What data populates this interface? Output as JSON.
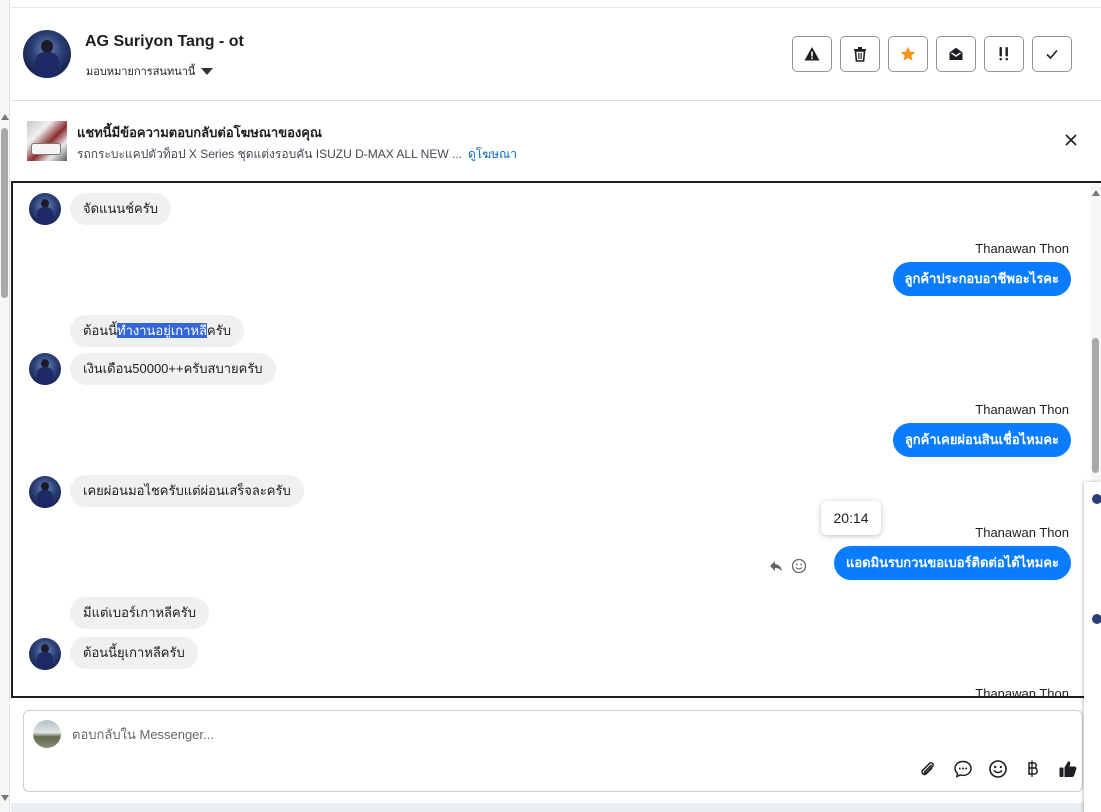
{
  "header": {
    "contact_name": "AG Suriyon Tang - ot",
    "assign_label": "มอบหมายการสนทนานี้",
    "actions": [
      {
        "name": "spam-button",
        "icon": "warning-icon"
      },
      {
        "name": "delete-button",
        "icon": "trash-icon"
      },
      {
        "name": "star-button",
        "icon": "star-icon"
      },
      {
        "name": "mark-unread-button",
        "icon": "envelope-open-icon"
      },
      {
        "name": "follow-up-button",
        "icon": "double-exclamation-icon"
      },
      {
        "name": "done-button",
        "icon": "check-icon"
      }
    ]
  },
  "ad_banner": {
    "title": "แชทนี้มีข้อความตอบกลับต่อโฆษณาของคุณ",
    "subtitle": "รถกระบะแคปตัวท็อป X Series ชุดแต่งรอบคัน ISUZU D-MAX ALL NEW ...",
    "link_label": "ดูโฆษณา"
  },
  "conversation": {
    "agent_name": "Thanawan Thon",
    "tooltip_time": "20:14",
    "messages": [
      {
        "from": "customer",
        "text": "จัดแนนช์ครับ"
      },
      {
        "from": "agent",
        "text": "ลูกค้าประกอบอาชีพอะไรคะ"
      },
      {
        "from": "customer",
        "text_before": "ต้อนนี้",
        "text_highlight": "ทำงานอยู่เกาหลี",
        "text_after": "ครับ"
      },
      {
        "from": "customer",
        "text": "เงินเดือน50000++ครับสบายครับ"
      },
      {
        "from": "agent",
        "text": "ลูกค้าเคยผ่อนสินเชื่อไหมคะ"
      },
      {
        "from": "customer",
        "text": "เคยผ่อนมอไชครับแต่ผ่อนเสร็จละครับ"
      },
      {
        "from": "agent",
        "text": "แอดมินรบกวนขอเบอร์ติดต่อได้ไหมคะ"
      },
      {
        "from": "customer",
        "text": "มีแต่เบอร์เกาหลีครับ"
      },
      {
        "from": "customer",
        "text": "ต้อนนี้ยุเกาหลีครับ"
      }
    ]
  },
  "composer": {
    "placeholder": "ตอบกลับใน Messenger...",
    "tools": [
      "attach-icon",
      "saved-reply-icon",
      "emoji-icon",
      "baht-payment-icon",
      "thumbs-up-icon"
    ]
  },
  "colors": {
    "agent_bubble": "#0a7cff",
    "customer_bubble": "#f0f0f0",
    "star": "#f5961c",
    "link": "#0a69c4"
  }
}
